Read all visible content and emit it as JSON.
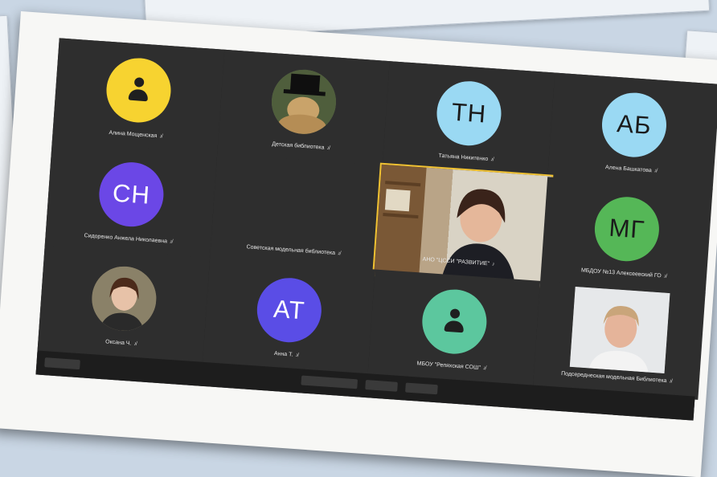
{
  "participants": [
    {
      "name": "Алина Мощенская",
      "initials": "",
      "color": "#f7d330",
      "type": "icon"
    },
    {
      "name": "Детская библиотека",
      "initials": "",
      "color": "#5d6b4e",
      "type": "photo"
    },
    {
      "name": "Татьяна Никитенко",
      "initials": "ТН",
      "color": "#9ad9f3",
      "type": "initials"
    },
    {
      "name": "Алена Башкатова",
      "initials": "АБ",
      "color": "#9ad9f3",
      "type": "initials"
    },
    {
      "name": "Сидоренко Анжела Николаевна",
      "initials": "СН",
      "color": "#6b47e6",
      "type": "initials"
    },
    {
      "name": "Советская модельная библиотека",
      "initials": "",
      "color": "#2e2e2e",
      "type": "blank"
    },
    {
      "name": "АНО \"ЦССИ \"РАЗВИТИЕ\"",
      "initials": "",
      "color": "#d9d3c5",
      "type": "video"
    },
    {
      "name": "МБДОУ №13 Алексеевский ГО",
      "initials": "МГ",
      "color": "#55b757",
      "type": "initials"
    },
    {
      "name": "Оксана Ч.",
      "initials": "",
      "color": "#6f6650",
      "type": "photo"
    },
    {
      "name": "Анна Т.",
      "initials": "АТ",
      "color": "#5a4de6",
      "type": "initials"
    },
    {
      "name": "МБОУ \"Репяхская СОШ\"",
      "initials": "",
      "color": "#5cc79e",
      "type": "icon"
    },
    {
      "name": "Подсереднеская модельная Библиотека",
      "initials": "",
      "color": "#e6e8ea",
      "type": "video"
    }
  ],
  "mic_icon": "mic-muted-icon"
}
